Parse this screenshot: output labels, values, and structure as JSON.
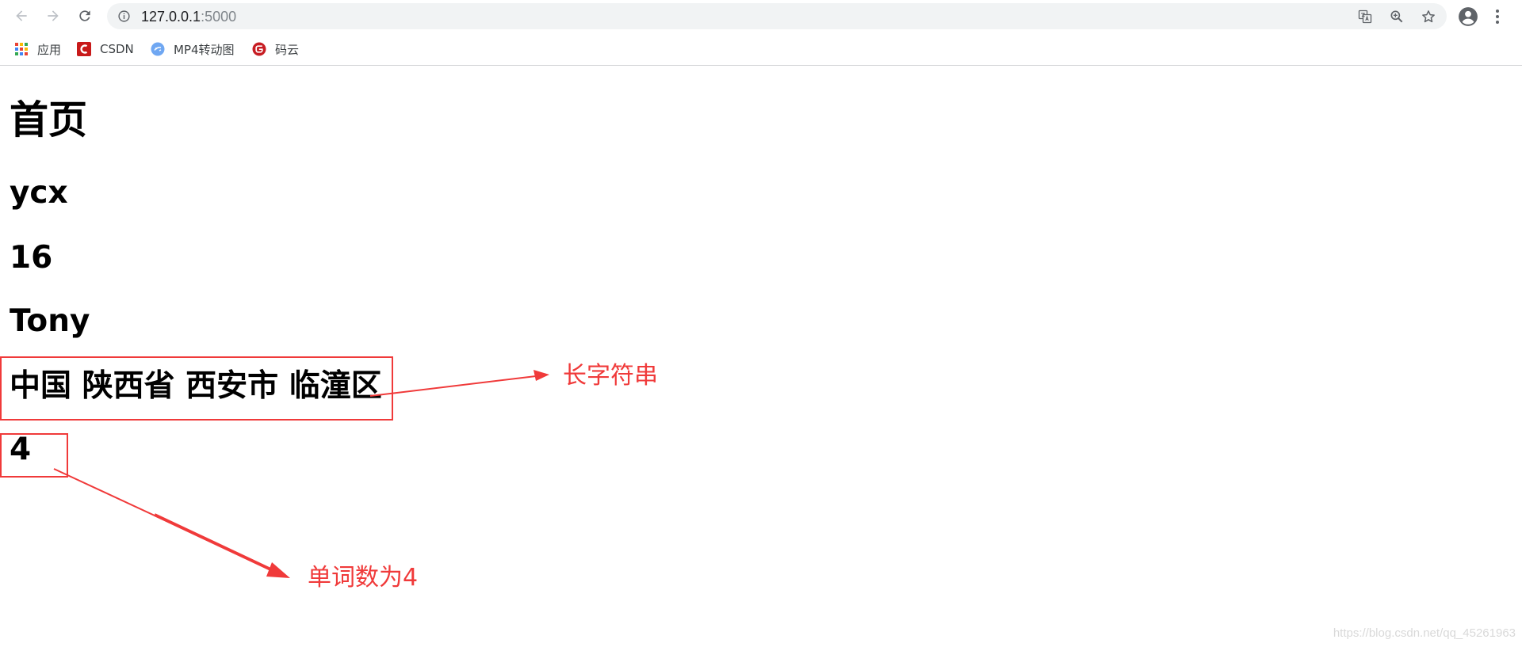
{
  "browser": {
    "url_host": "127.0.0.1",
    "url_port": ":5000",
    "icons": {
      "back": "arrow-left-icon",
      "forward": "arrow-right-icon",
      "reload": "reload-icon",
      "site_info": "info-icon",
      "translate": "translate-icon",
      "zoom": "zoom-icon",
      "bookmark": "star-icon",
      "profile": "account-circle-icon",
      "menu": "kebab-menu-icon"
    }
  },
  "bookmarks": [
    {
      "label": "应用",
      "icon": "apps-grid-icon"
    },
    {
      "label": "CSDN",
      "icon": "csdn-logo-icon"
    },
    {
      "label": "MP4转动图",
      "icon": "mp4-gif-icon"
    },
    {
      "label": "码云",
      "icon": "gitee-logo-icon"
    }
  ],
  "page": {
    "heading": "首页",
    "name": "ycx",
    "age": "16",
    "user": "Tony",
    "address": "中国 陕西省 西安市 临潼区",
    "word_count": "4"
  },
  "annotations": {
    "long_string_label": "长字符串",
    "word_count_label": "单词数为4",
    "color": "#f03a3a"
  },
  "watermark": "https://blog.csdn.net/qq_45261963"
}
